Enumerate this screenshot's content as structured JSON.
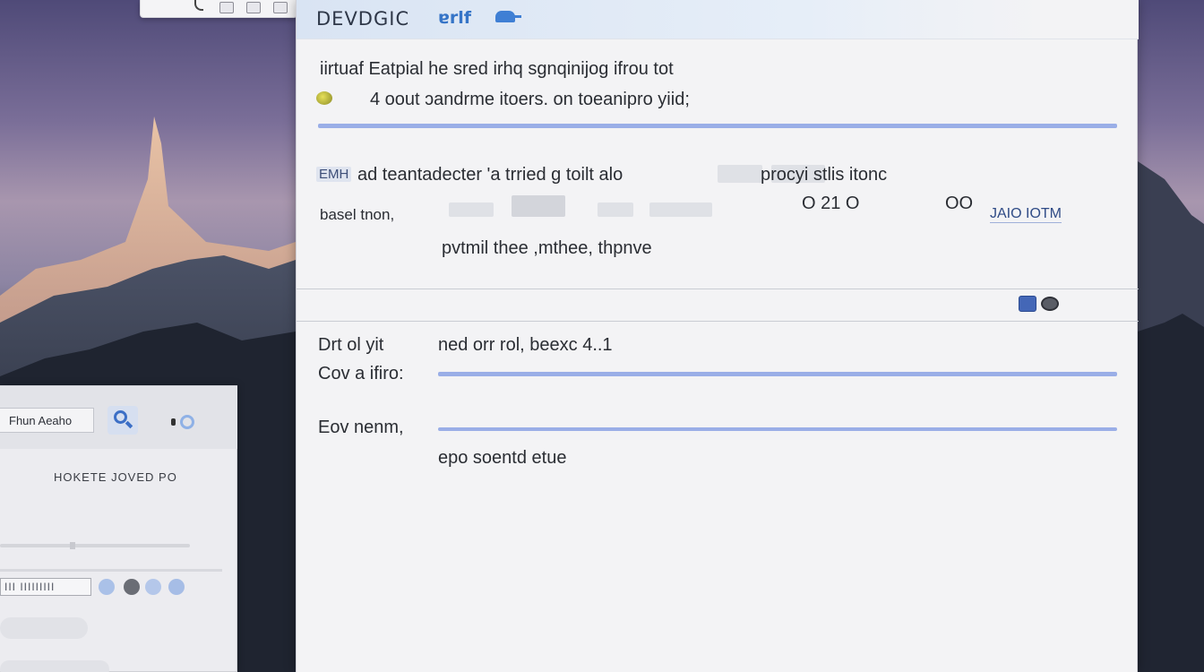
{
  "top_window": {
    "buttons": [
      "window-button-1",
      "window-button-2",
      "window-button-3"
    ]
  },
  "dialog": {
    "title": "DEVDGIC",
    "title_accent": "ɐrlf",
    "line1": "iirtuaf Eatpial he sred irhq sgnqinijog ifrou tot",
    "line2": "4 oout ɔandrme itoers. on toeanipro yiid;",
    "row3_badge": "EMH",
    "row3": "ad teantadecter 'a trried g toilt alo",
    "row3_tail": "procyi stlis itonc",
    "row4_label": "basel tnon,",
    "row4_mid": "O 21 O",
    "row4_mid2": "OO",
    "row4_link": "JAIO IOTM",
    "row5": "pvtmil thee ,mthee, thpnve",
    "form": {
      "label1": "Drt ol yit",
      "value1": "ned orr rol, beexc 4..1",
      "label2": "Cov a ifiro:",
      "label3": "Eov nenm,",
      "value3": "epo soentd etue"
    }
  },
  "side_window": {
    "tab_label": "Fhun Aeaho",
    "caption": "HOKETE JOVED PO",
    "field_value": "III IIIIIIIII"
  },
  "colors": {
    "accent": "#3574c7",
    "line": "#9aaee7"
  }
}
